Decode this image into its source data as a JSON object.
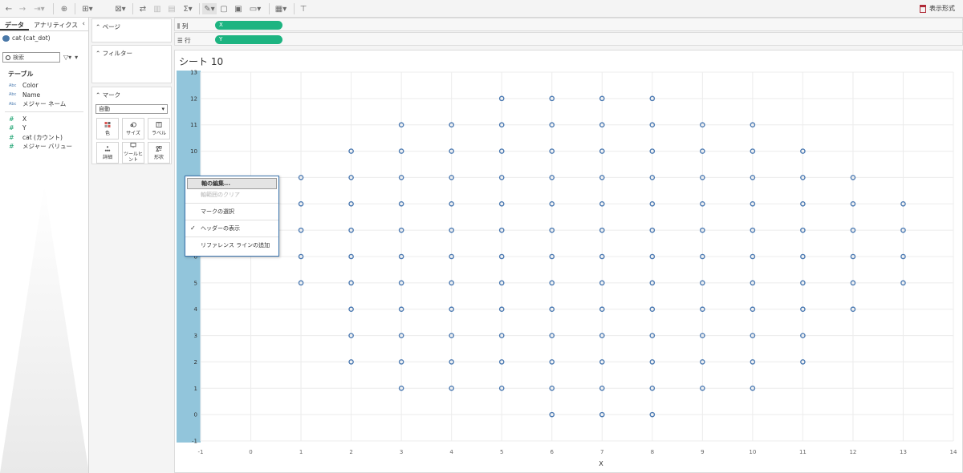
{
  "toolbar": {
    "right_label": "表示形式",
    "buttons": [
      "undo-icon",
      "redo-icon",
      "save-icon",
      "new-datasource-icon",
      "new-sheet-icon",
      "duplicate-sheet-icon",
      "swap-icon",
      "sort-asc-icon",
      "sort-desc-icon",
      "totals-icon",
      "highlight-icon",
      "text-label-icon",
      "tooltip-icon",
      "fit-icon",
      "show-cards-icon",
      "presentation-icon"
    ]
  },
  "left_pane": {
    "tabs": [
      "データ",
      "アナリティクス"
    ],
    "datasource": "cat (cat_dot)",
    "search_placeholder": "検索",
    "table_header": "テーブル",
    "dim_fields": [
      {
        "type": "Abc",
        "name": "Color"
      },
      {
        "type": "Abc",
        "name": "Name"
      },
      {
        "type": "Abc",
        "name": "メジャー ネーム"
      }
    ],
    "measure_fields": [
      {
        "type": "#",
        "name": "X"
      },
      {
        "type": "#",
        "name": "Y"
      },
      {
        "type": "#",
        "name": "cat (カウント)"
      },
      {
        "type": "#",
        "name": "メジャー バリュー"
      }
    ]
  },
  "cards": {
    "pages": "ページ",
    "filters": "フィルター",
    "marks": "マーク",
    "mark_type": "自動",
    "buttons": [
      {
        "label": "色",
        "icon": "color-icon"
      },
      {
        "label": "サイズ",
        "icon": "size-icon"
      },
      {
        "label": "ラベル",
        "icon": "label-icon"
      },
      {
        "label": "詳細",
        "icon": "detail-icon"
      },
      {
        "label": "ツールヒ\nント",
        "icon": "tooltip-icon"
      },
      {
        "label": "形状",
        "icon": "shape-icon"
      }
    ]
  },
  "shelves": {
    "columns_label": "列",
    "rows_label": "行",
    "columns_pill": "X",
    "rows_pill": "Y"
  },
  "sheet": {
    "title": "シート 10"
  },
  "context_menu": {
    "items": [
      {
        "label": "軸の編集...",
        "state": "highlighted"
      },
      {
        "label": "軸範囲のクリア",
        "state": "disabled"
      },
      {
        "label": "マークの選択",
        "state": "normal"
      },
      {
        "label": "ヘッダーの表示",
        "state": "checked"
      },
      {
        "label": "リファレンス ラインの追加",
        "state": "normal"
      }
    ]
  },
  "colors": {
    "pill": "#1db481",
    "axis_highlight": "#92c5db",
    "mark": "#4c7ab2"
  },
  "chart_data": {
    "type": "scatter",
    "xlabel": "X",
    "ylabel": "",
    "xlim": [
      -1,
      14
    ],
    "ylim": [
      -1,
      13
    ],
    "x_ticks": [
      -1,
      0,
      1,
      2,
      3,
      4,
      5,
      6,
      7,
      8,
      9,
      10,
      11,
      12,
      13,
      14
    ],
    "y_ticks": [
      -1,
      0,
      1,
      2,
      3,
      4,
      5,
      6,
      7,
      8,
      9,
      10,
      11,
      12,
      13
    ],
    "marker": "open-circle",
    "columns": [
      {
        "x": 1,
        "y": [
          5,
          6,
          7,
          8,
          9
        ]
      },
      {
        "x": 2,
        "y": [
          2,
          3,
          4,
          5,
          6,
          7,
          8,
          9,
          10
        ]
      },
      {
        "x": 3,
        "y": [
          1,
          2,
          3,
          4,
          5,
          6,
          7,
          8,
          9,
          10,
          11
        ]
      },
      {
        "x": 4,
        "y": [
          1,
          2,
          3,
          4,
          5,
          6,
          7,
          8,
          9,
          10,
          11
        ]
      },
      {
        "x": 5,
        "y": [
          1,
          2,
          3,
          4,
          5,
          6,
          7,
          8,
          9,
          10,
          11,
          12
        ]
      },
      {
        "x": 6,
        "y": [
          0,
          1,
          2,
          3,
          4,
          5,
          6,
          7,
          8,
          9,
          10,
          11,
          12
        ]
      },
      {
        "x": 7,
        "y": [
          0,
          1,
          2,
          3,
          4,
          5,
          6,
          7,
          8,
          9,
          10,
          11,
          12
        ]
      },
      {
        "x": 8,
        "y": [
          0,
          1,
          2,
          3,
          4,
          5,
          6,
          7,
          8,
          9,
          10,
          11,
          12
        ]
      },
      {
        "x": 9,
        "y": [
          1,
          2,
          3,
          4,
          5,
          6,
          7,
          8,
          9,
          10,
          11
        ]
      },
      {
        "x": 10,
        "y": [
          1,
          2,
          3,
          4,
          5,
          6,
          7,
          8,
          9,
          10,
          11
        ]
      },
      {
        "x": 11,
        "y": [
          2,
          3,
          4,
          5,
          6,
          7,
          8,
          9,
          10
        ]
      },
      {
        "x": 12,
        "y": [
          4,
          5,
          6,
          7,
          8,
          9
        ]
      },
      {
        "x": 13,
        "y": [
          5,
          6,
          7,
          8
        ]
      }
    ]
  }
}
